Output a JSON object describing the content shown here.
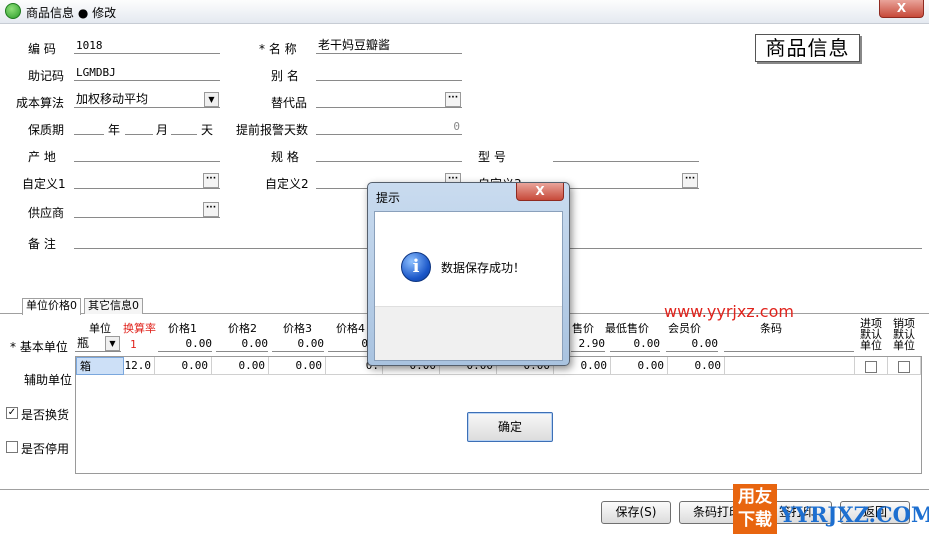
{
  "window": {
    "title": "商品信息 ● 修改",
    "close": "X"
  },
  "stamp": "商品信息",
  "form": {
    "code_label": "编  码",
    "code_value": "1018",
    "name_label": "* 名  称",
    "name_value": "老干妈豆瓣酱",
    "mnemonic_label": "助记码",
    "mnemonic_value": "LGMDBJ",
    "alias_label": "别  名",
    "alias_value": "",
    "cost_label": "成本算法",
    "cost_value": "加权移动平均",
    "substitute_label": "替代品",
    "substitute_value": "",
    "shelf_label": "保质期",
    "year": "年",
    "month": "月",
    "day": "天",
    "warn_label": "提前报警天数",
    "warn_value": "0",
    "origin_label": "产  地",
    "origin_value": "",
    "spec_label": "规  格",
    "spec_value": "",
    "model_label": "型  号",
    "model_value": "",
    "custom1_label": "自定义1",
    "custom1_value": "",
    "custom2_label": "自定义2",
    "custom2_value": "",
    "custom3_label": "自定义3",
    "custom3_value": "",
    "supplier_label": "供应商",
    "supplier_value": "",
    "remark_label": "备  注",
    "remark_value": "",
    "dots": "···",
    "dropdown_glyph": "▼"
  },
  "tabs": [
    {
      "label": "单位价格0"
    },
    {
      "label": "其它信息0"
    }
  ],
  "grid": {
    "headers": {
      "unit": "单位",
      "rate": "换算率",
      "price1": "价格1",
      "price2": "价格2",
      "price3": "价格3",
      "price4": "价格4",
      "retail": "售价",
      "min": "最低售价",
      "member": "会员价",
      "barcode": "条码",
      "in_default": "进项默认单位",
      "out_default": "销项默认单位"
    },
    "base_label": "* 基本单位",
    "aux_label": "辅助单位",
    "base_row": {
      "unit": "瓶",
      "rate": "1",
      "price1": "0.00",
      "price2": "0.00",
      "price3": "0.00",
      "price4": "0",
      "retail": "2.90",
      "min": "0.00",
      "member": "0.00"
    },
    "aux_row": {
      "unit": "箱",
      "rate": "12.0",
      "price1": "0.00",
      "price2": "0.00",
      "price3": "0.00",
      "price4": "0.",
      "col5": "0.00",
      "col6": "0.00",
      "col7": "0.00",
      "min": "0.00",
      "member": "0.00"
    },
    "exchange_label": "是否换货",
    "disable_label": "是否停用",
    "check": "✓"
  },
  "buttons": {
    "save": "保存(S)",
    "barcode_print": "条码打印",
    "label_print": "签打印",
    "back": "返回"
  },
  "dialog": {
    "title": "提示",
    "close": "X",
    "icon": "i",
    "message": "数据保存成功！",
    "ok": "确定"
  },
  "watermark": {
    "url": "www.yyrjxz.com",
    "badge_line1": "用友",
    "badge_line2": "下载",
    "brand": "YYRJXZ.COM"
  },
  "colors": {
    "accent_red": "#e0231c",
    "dialog_blue": "#a9c3e0",
    "badge_orange": "#e8650f"
  }
}
